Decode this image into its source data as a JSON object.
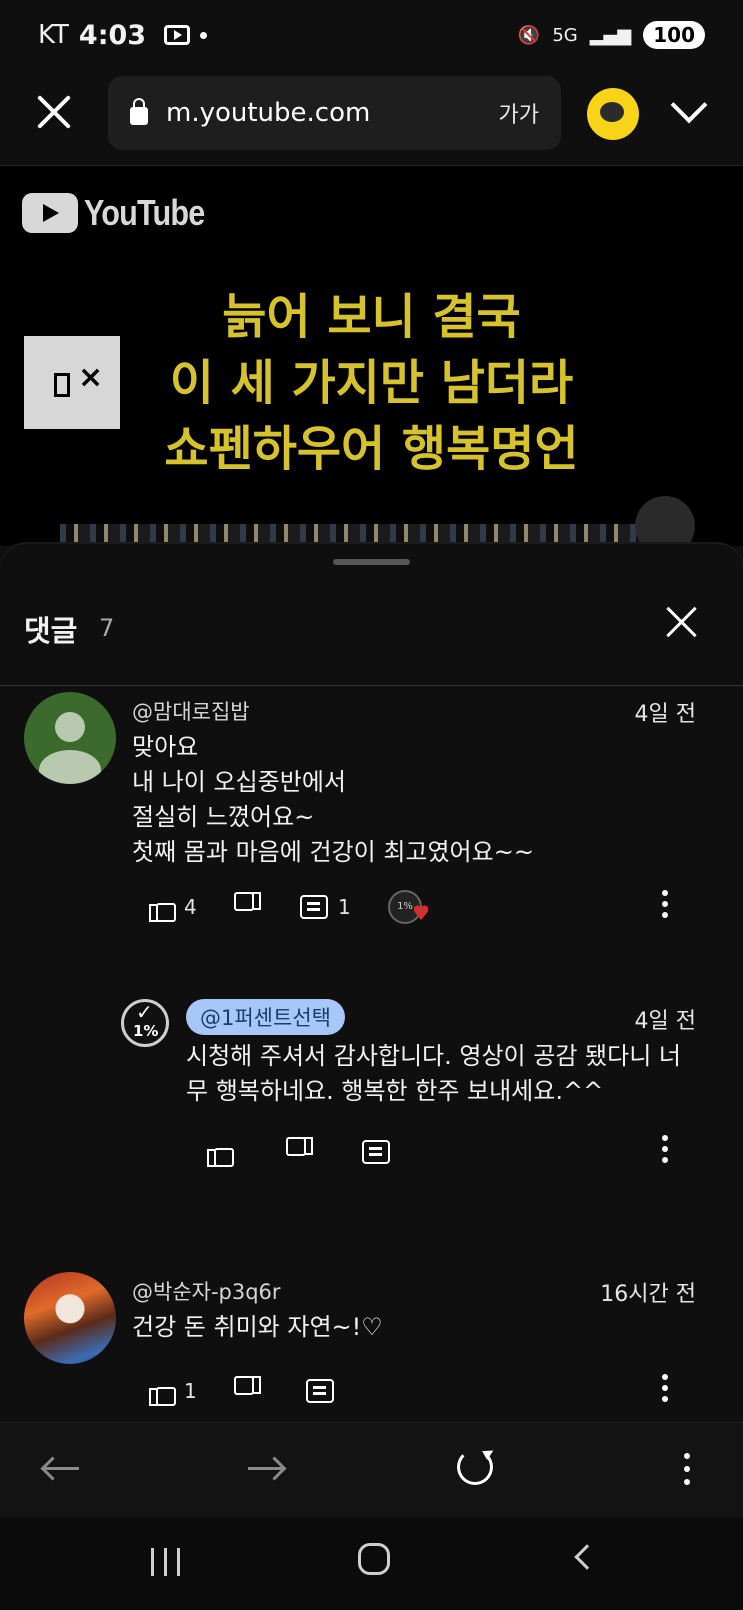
{
  "status_bar": {
    "carrier": "KT",
    "time": "4:03",
    "network": "5G",
    "battery": "100"
  },
  "browser": {
    "url": "m.youtube.com",
    "font_size_label": "가가"
  },
  "video": {
    "logo_text": "YouTube",
    "title_lines": [
      "늙어 보니 결국",
      "이 세 가지만 남더라",
      "쇼펜하우어 행복명언"
    ],
    "title_color": "#d6c22c"
  },
  "comments_panel": {
    "title": "댓글",
    "count": "7",
    "comments": [
      {
        "author": "@맘대로집밥",
        "time": "4일 전",
        "text": "맞아요\n내 나이 오십중반에서\n절실히 느꼈어요~\n첫째 몸과 마음에 건강이 최고였어요~~",
        "likes": "4",
        "replies": "1",
        "creator_badge": "1%"
      },
      {
        "author": "@1퍼센트선택",
        "time": "4일 전",
        "text": "시청해 주셔서 감사합니다. 영상이 공감 됐다니 너\n무 행복하네요. 행복한 한주 보내세요.^^",
        "avatar_badge": "1%"
      },
      {
        "author": "@박순자-p3q6r",
        "time": "16시간 전",
        "text": "건강 돈 취미와 자연~!♡",
        "likes": "1"
      }
    ]
  },
  "colors": {
    "background": "#0f0f0f",
    "pill": "#a7c7f7",
    "kakao": "#f7d417"
  }
}
